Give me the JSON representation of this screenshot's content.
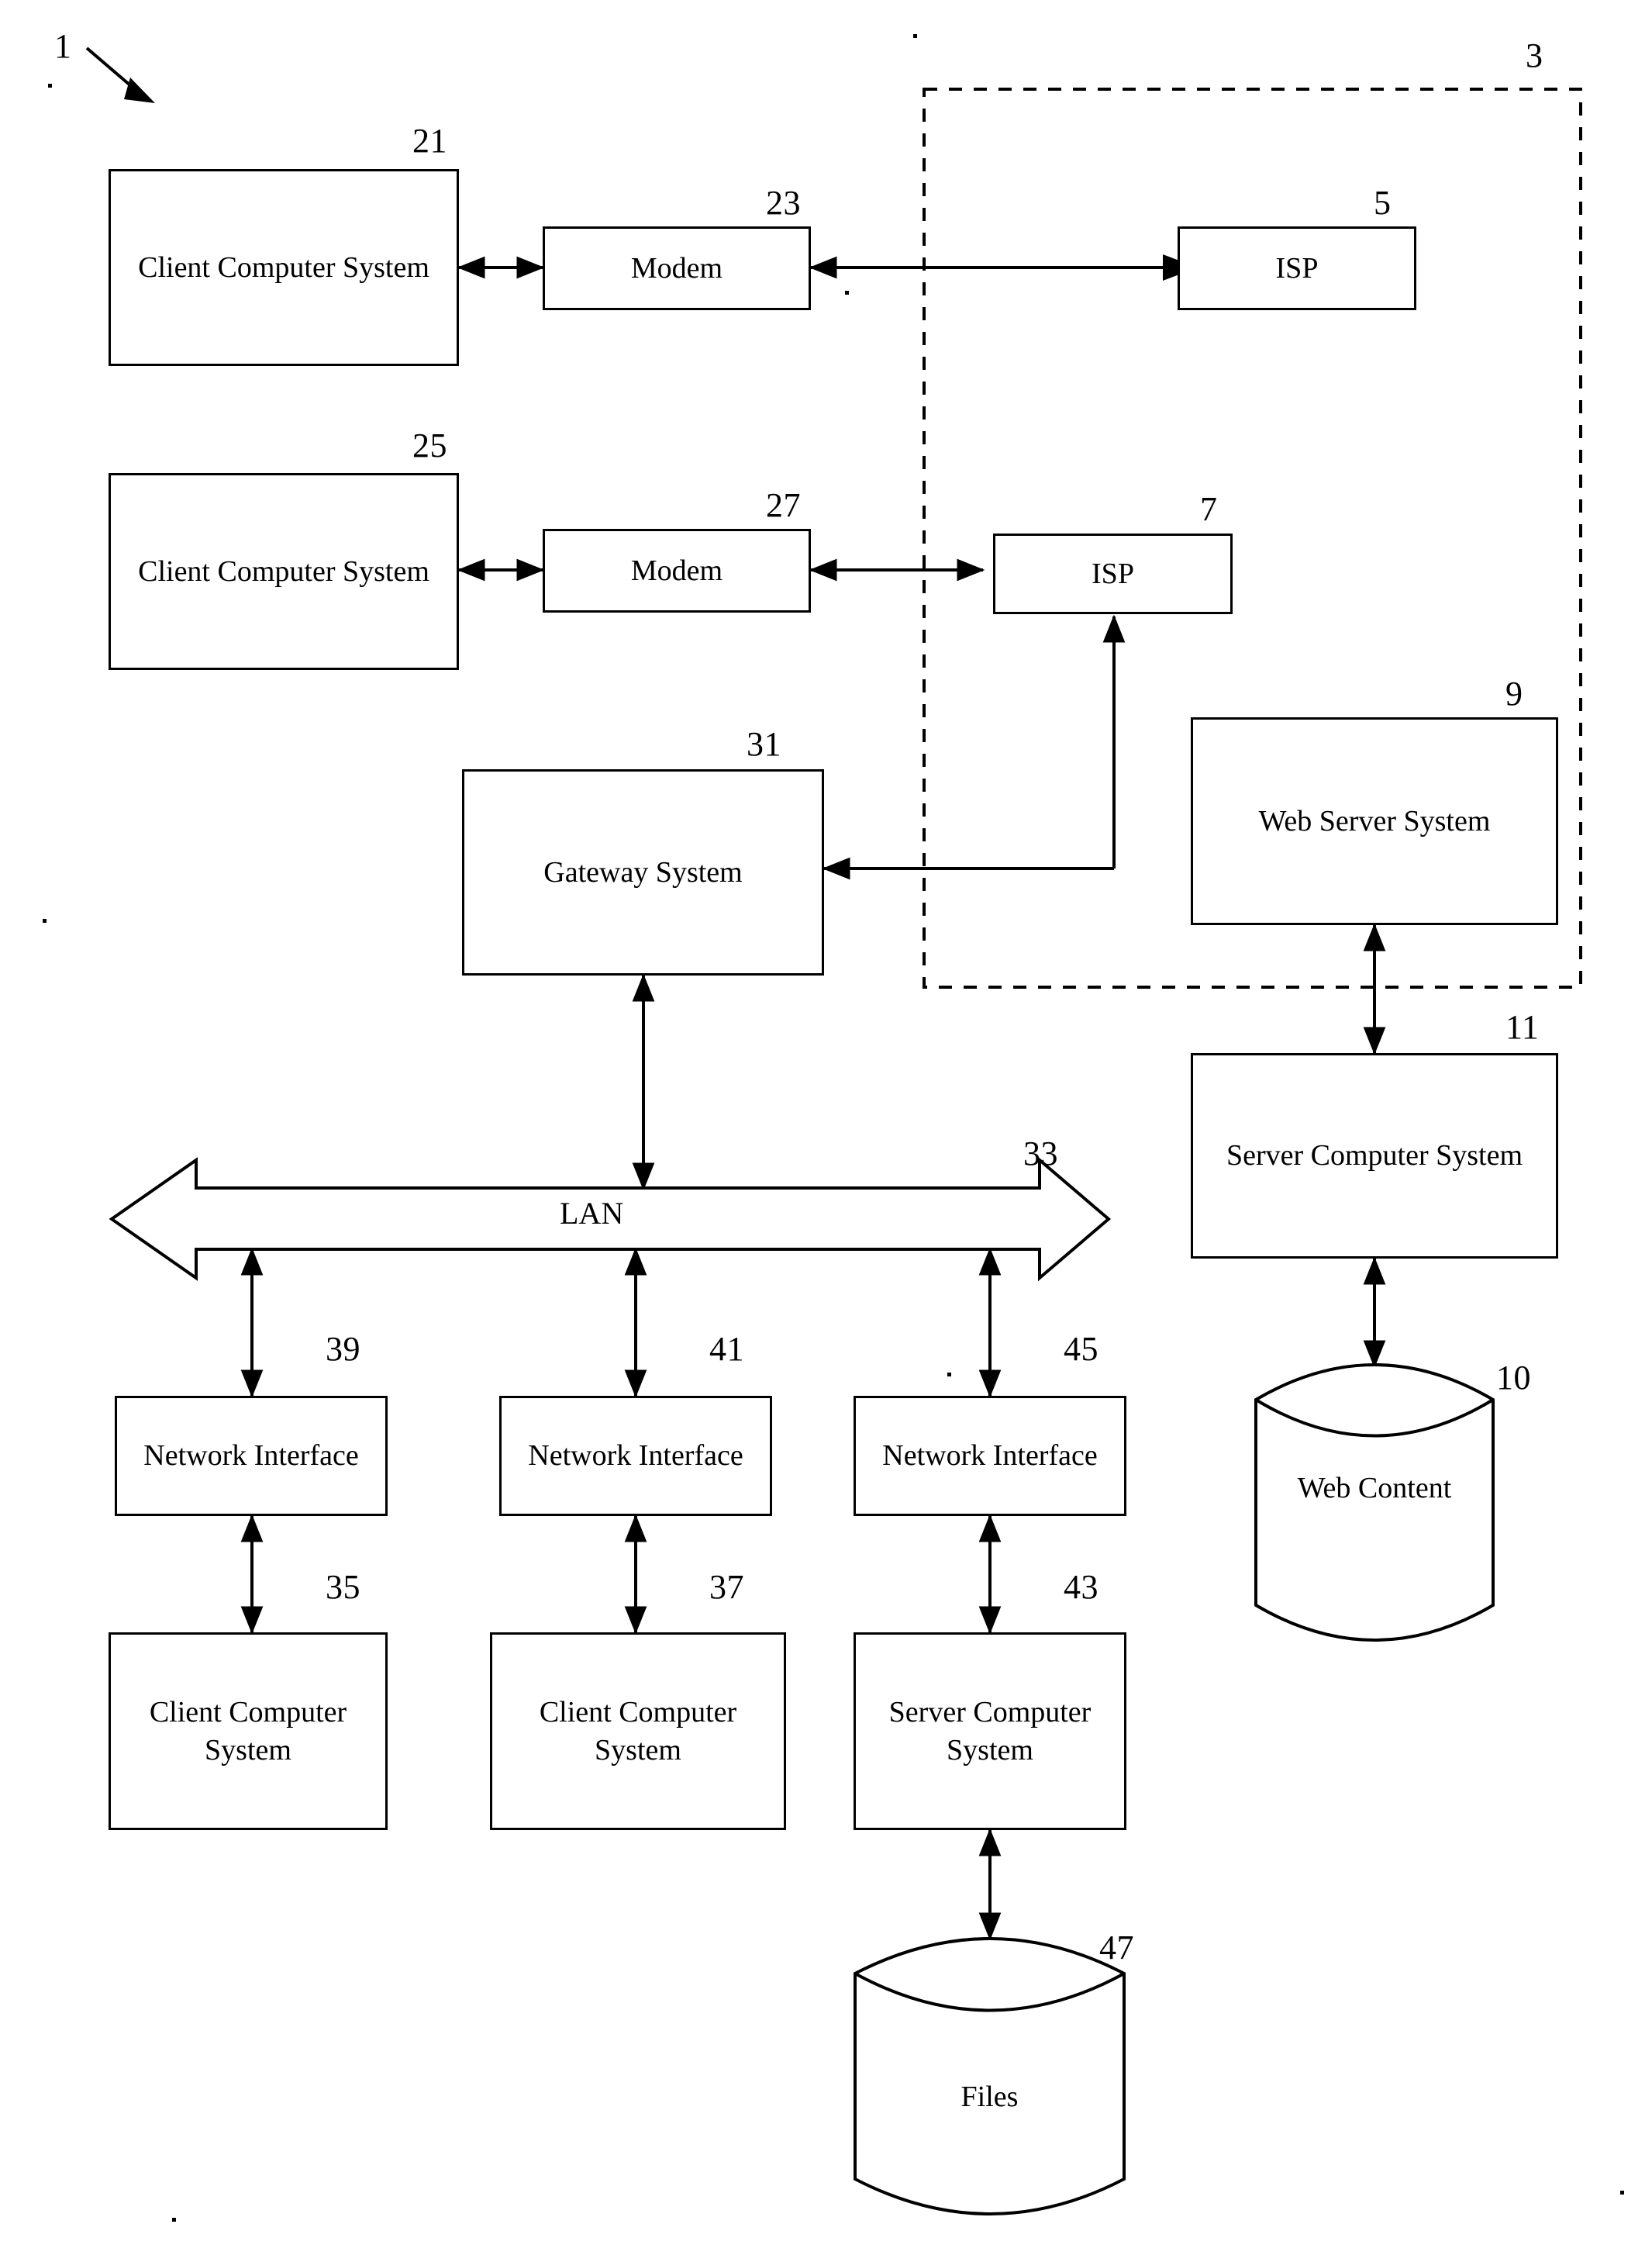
{
  "figure": {
    "ref_main": "1",
    "internet_cloud_ref": "3"
  },
  "nodes": {
    "client_computer_system_21": {
      "label": "Client Computer System",
      "ref": "21"
    },
    "modem_23": {
      "label": "Modem",
      "ref": "23"
    },
    "isp_5": {
      "label": "ISP",
      "ref": "5"
    },
    "client_computer_system_25": {
      "label": "Client Computer System",
      "ref": "25"
    },
    "modem_27": {
      "label": "Modem",
      "ref": "27"
    },
    "isp_7": {
      "label": "ISP",
      "ref": "7"
    },
    "gateway_system_31": {
      "label": "Gateway System",
      "ref": "31"
    },
    "web_server_system_9": {
      "label": "Web Server System",
      "ref": "9"
    },
    "server_computer_system_11": {
      "label": "Server Computer System",
      "ref": "11"
    },
    "web_content_10": {
      "label": "Web Content",
      "ref": "10"
    },
    "lan_33": {
      "label": "LAN",
      "ref": "33"
    },
    "network_interface_39": {
      "label": "Network Interface",
      "ref": "39"
    },
    "network_interface_41": {
      "label": "Network Interface",
      "ref": "41"
    },
    "network_interface_45": {
      "label": "Network Interface",
      "ref": "45"
    },
    "client_computer_system_35": {
      "label": "Client Computer System",
      "ref": "35"
    },
    "client_computer_system_37": {
      "label": "Client Computer System",
      "ref": "37"
    },
    "server_computer_system_43": {
      "label": "Server Computer System",
      "ref": "43"
    },
    "files_47": {
      "label": "Files",
      "ref": "47"
    }
  },
  "colors": {
    "ink": "#000000",
    "paper": "#ffffff"
  },
  "chart_data": {
    "type": "diagram",
    "title": "",
    "nodes": [
      {
        "id": "21",
        "label": "Client Computer System",
        "shape": "rect"
      },
      {
        "id": "23",
        "label": "Modem",
        "shape": "rect"
      },
      {
        "id": "5",
        "label": "ISP",
        "shape": "rect"
      },
      {
        "id": "25",
        "label": "Client Computer System",
        "shape": "rect"
      },
      {
        "id": "27",
        "label": "Modem",
        "shape": "rect"
      },
      {
        "id": "7",
        "label": "ISP",
        "shape": "rect"
      },
      {
        "id": "31",
        "label": "Gateway System",
        "shape": "rect"
      },
      {
        "id": "9",
        "label": "Web Server System",
        "shape": "rect"
      },
      {
        "id": "11",
        "label": "Server Computer System",
        "shape": "rect"
      },
      {
        "id": "10",
        "label": "Web Content",
        "shape": "cylinder"
      },
      {
        "id": "33",
        "label": "LAN",
        "shape": "double-arrow-bus"
      },
      {
        "id": "39",
        "label": "Network Interface",
        "shape": "rect"
      },
      {
        "id": "41",
        "label": "Network Interface",
        "shape": "rect"
      },
      {
        "id": "45",
        "label": "Network Interface",
        "shape": "rect"
      },
      {
        "id": "35",
        "label": "Client Computer System",
        "shape": "rect"
      },
      {
        "id": "37",
        "label": "Client Computer System",
        "shape": "rect"
      },
      {
        "id": "43",
        "label": "Server Computer System",
        "shape": "rect"
      },
      {
        "id": "47",
        "label": "Files",
        "shape": "cylinder"
      },
      {
        "id": "3",
        "label": "",
        "shape": "dashed-boundary"
      },
      {
        "id": "1",
        "label": "",
        "shape": "lead-arrow"
      }
    ],
    "edges": [
      {
        "from": "21",
        "to": "23",
        "type": "bidirectional"
      },
      {
        "from": "23",
        "to": "5",
        "type": "bidirectional"
      },
      {
        "from": "25",
        "to": "27",
        "type": "bidirectional"
      },
      {
        "from": "27",
        "to": "7",
        "type": "bidirectional"
      },
      {
        "from": "7",
        "to": "31",
        "type": "bidirectional"
      },
      {
        "from": "31",
        "to": "33",
        "type": "bidirectional"
      },
      {
        "from": "9",
        "to": "11",
        "type": "bidirectional"
      },
      {
        "from": "11",
        "to": "10",
        "type": "bidirectional"
      },
      {
        "from": "33",
        "to": "39",
        "type": "bidirectional"
      },
      {
        "from": "33",
        "to": "41",
        "type": "bidirectional"
      },
      {
        "from": "33",
        "to": "45",
        "type": "bidirectional"
      },
      {
        "from": "39",
        "to": "35",
        "type": "bidirectional"
      },
      {
        "from": "41",
        "to": "37",
        "type": "bidirectional"
      },
      {
        "from": "45",
        "to": "43",
        "type": "bidirectional"
      },
      {
        "from": "43",
        "to": "47",
        "type": "bidirectional"
      }
    ]
  }
}
